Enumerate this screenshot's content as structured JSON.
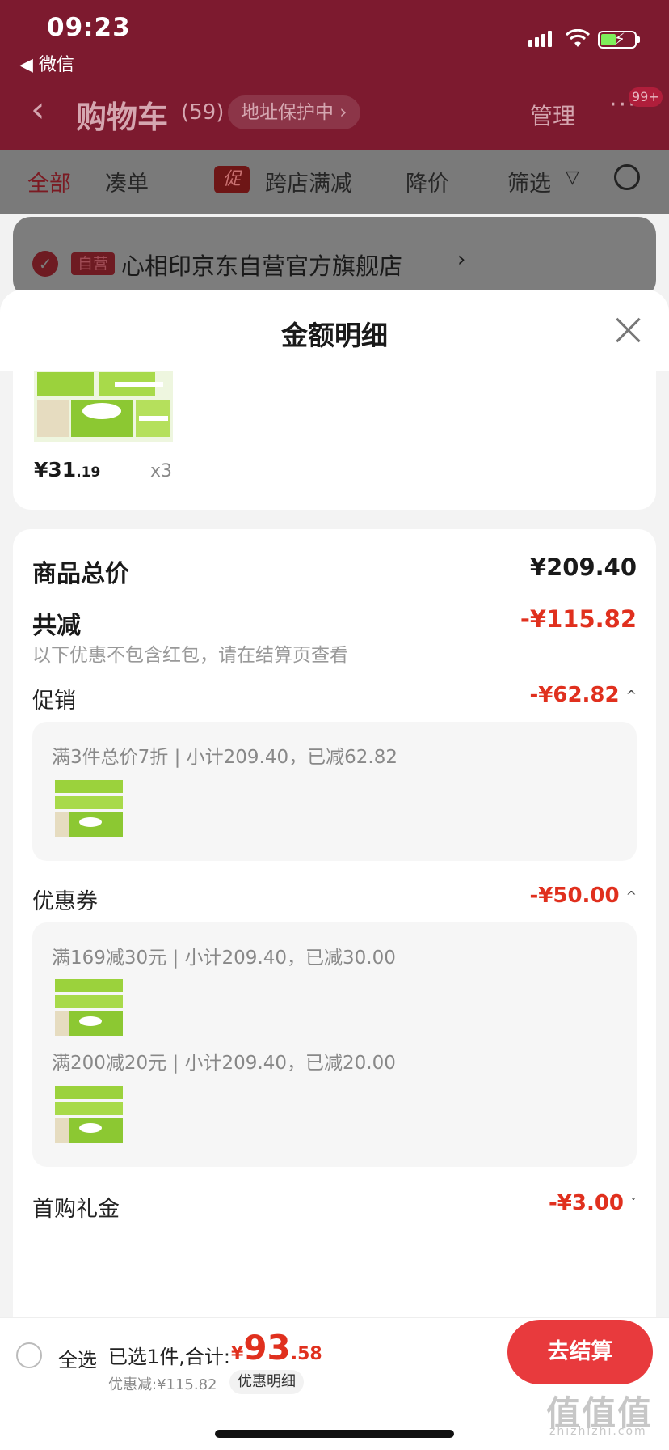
{
  "status_bar": {
    "time": "09:23",
    "back_app": "◀ 微信"
  },
  "nav": {
    "title": "购物车",
    "count": "(59)",
    "address_protect": "地址保护中 ›",
    "manage": "管理",
    "more": "···",
    "badge": "99+"
  },
  "filters": {
    "all": "全部",
    "combine": "凑单",
    "cu_tag": "促",
    "cross_store": "跨店满减",
    "price_drop": "降价",
    "filter": "筛选"
  },
  "store": {
    "tag": "自营",
    "name": "心相印京东自营官方旗舰店",
    "arrow": "›"
  },
  "sheet": {
    "title": "金额明细",
    "item": {
      "price_int": "¥31",
      "price_dec": ".19",
      "qty": "x3"
    },
    "total_label": "商品总价",
    "total_value": "¥209.40",
    "reduce_label": "共减",
    "reduce_value": "-¥115.82",
    "note": "以下优惠不包含红包，请在结算页查看",
    "promo": {
      "label": "促销",
      "value": "-¥62.82",
      "chevron": "^",
      "line": "满3件总价7折 | 小计209.40，已减62.82"
    },
    "coupon": {
      "label": "优惠券",
      "value": "-¥50.00",
      "chevron": "^",
      "line1": "满169减30元 | 小计209.40，已减30.00",
      "line2": "满200减20元 | 小计209.40，已减20.00"
    },
    "gift": {
      "label": "首购礼金",
      "value": "-¥3.00",
      "chevron": "ˇ"
    }
  },
  "bottom_bar": {
    "select_all": "全选",
    "selected": "已选1件,合计:",
    "total_cur": "¥",
    "total_int": "93",
    "total_dec": ".58",
    "saving": "优惠减:¥115.82",
    "detail_btn": "优惠明细",
    "checkout": "去结算"
  },
  "watermark": {
    "text": "值值值",
    "sub": "zhizhizhi.com"
  },
  "colors": {
    "accent_red": "#e0301e",
    "checkout_red": "#e83a3d",
    "header_bg": "#7d1a2f"
  }
}
